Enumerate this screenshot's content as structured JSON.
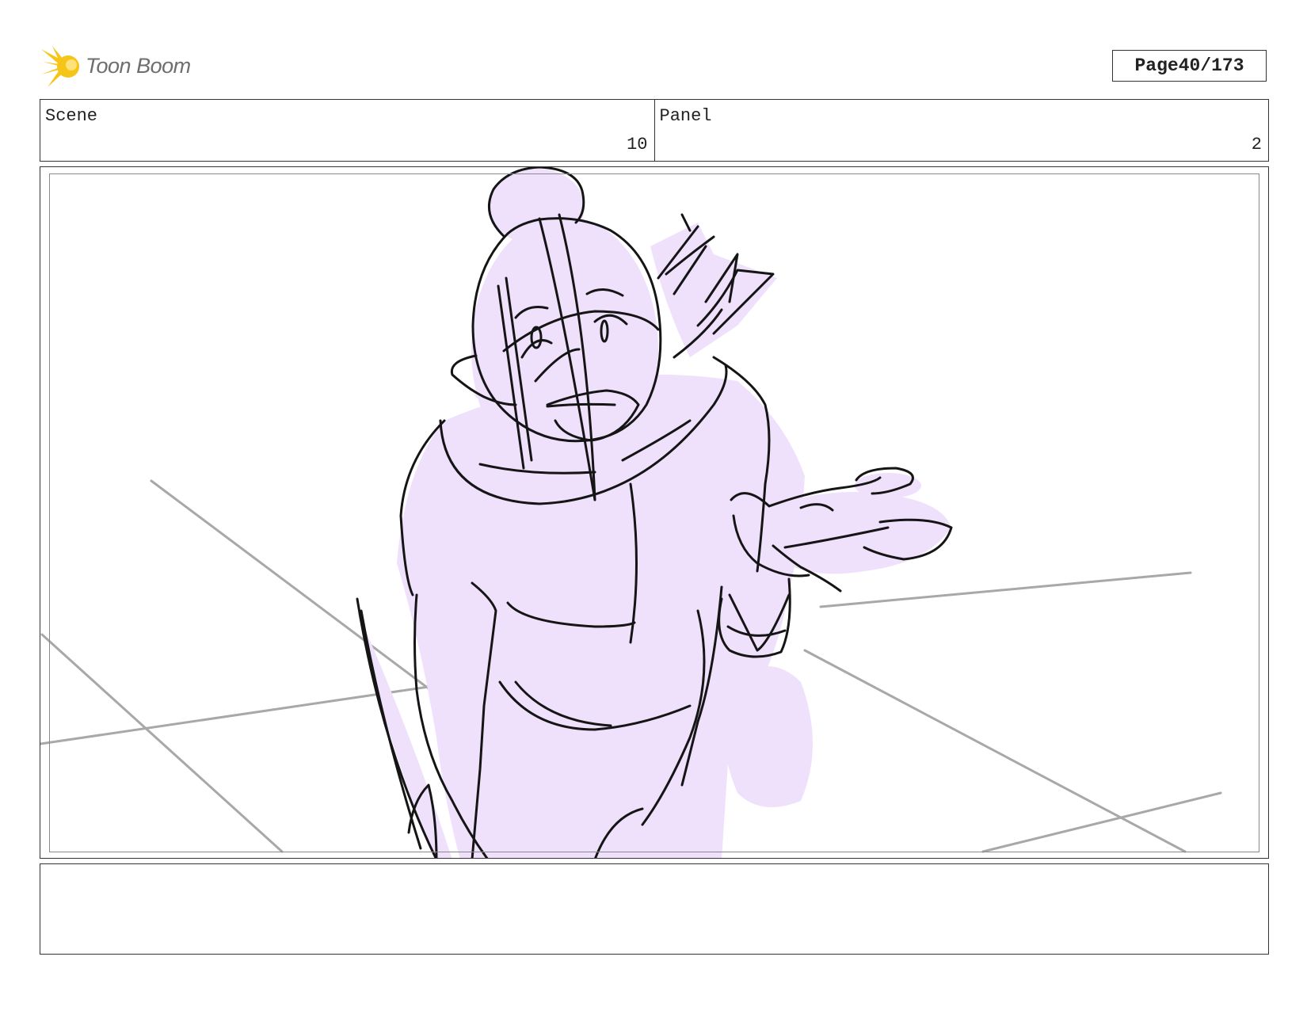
{
  "brand": {
    "name": "Toon Boom",
    "accent": "#f5c518"
  },
  "page": {
    "label": "Page",
    "current": "40",
    "total": "173",
    "text": "40/173"
  },
  "scene": {
    "label": "Scene",
    "value": "10"
  },
  "panel": {
    "label": "Panel",
    "value": "2"
  },
  "colors": {
    "sketch_fill": "#efe0fb",
    "sketch_line": "#151515",
    "floor_line": "#a8a8a8",
    "border": "#333333"
  },
  "notes": {
    "text": ""
  }
}
